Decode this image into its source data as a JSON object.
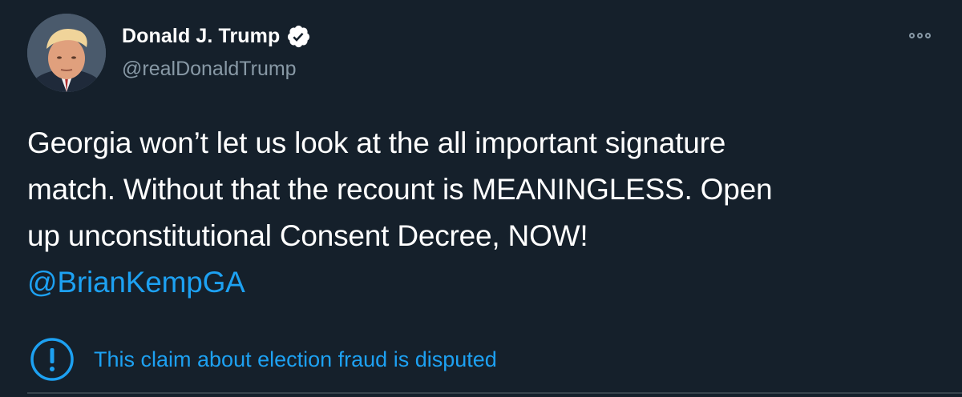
{
  "author": {
    "display_name": "Donald J. Trump",
    "handle": "@realDonaldTrump",
    "verified": true
  },
  "icons": {
    "avatar": "profile-photo",
    "verified": "verified-badge-icon",
    "more": "more-options-icon",
    "notice": "exclamation-circle-icon"
  },
  "tweet": {
    "lines": [
      "Georgia won’t let us look at the all important signature",
      "match. Without that the recount is MEANINGLESS. Open",
      "up unconstitutional Consent Decree, NOW!"
    ],
    "mention": "@BrianKempGA"
  },
  "notice": {
    "text": "This claim about election fraud is disputed"
  },
  "colors": {
    "background": "#15202b",
    "accent": "#1da1f2",
    "muted": "#8899a6",
    "text": "#ffffff"
  }
}
